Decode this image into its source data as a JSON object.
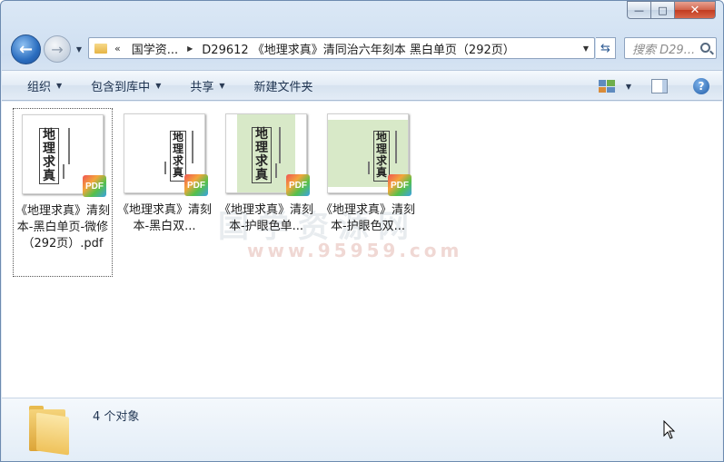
{
  "window": {
    "caption_buttons": {
      "min": "—",
      "max": "□",
      "close": "✕"
    }
  },
  "address_bar": {
    "overflow": "«",
    "segments": [
      "国学资...",
      "D29612 《地理求真》清同治六年刻本 黑白单页（292页）"
    ]
  },
  "search": {
    "placeholder": "搜索 D29..."
  },
  "toolbar": {
    "organize": "组织",
    "include_in_library": "包含到库中",
    "share": "共享",
    "new_folder": "新建文件夹"
  },
  "watermark": {
    "text": "国学资源网",
    "url": "www.95959.com"
  },
  "files": [
    {
      "name": "《地理求真》清刻本-黑白单页-微修（292页）.pdf",
      "variant": "white",
      "selected": true,
      "badge": "PDF"
    },
    {
      "name": "《地理求真》清刻本-黑白双...",
      "variant": "white-double",
      "selected": false,
      "badge": "PDF"
    },
    {
      "name": "《地理求真》清刻本-护眼色单...",
      "variant": "green-single",
      "selected": false,
      "badge": "PDF"
    },
    {
      "name": "《地理求真》清刻本-护眼色双...",
      "variant": "green-double",
      "selected": false,
      "badge": "PDF"
    }
  ],
  "status": {
    "count": "4 个对象"
  },
  "colors": {
    "eye_care_green": "#d8e9c8",
    "selection_border": "#555555"
  }
}
